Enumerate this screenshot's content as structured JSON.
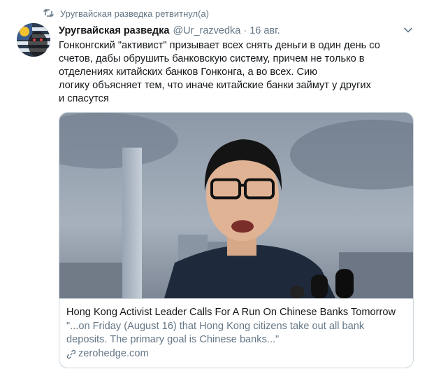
{
  "retweet": {
    "icon": "retweet-icon",
    "text": "Уругвайская разведка ретвитнул(а)"
  },
  "tweet": {
    "author_name": "Уругвайская разведка",
    "handle": "@Ur_razvedka",
    "separator": "·",
    "date": "16 авг.",
    "text": "Гонконгский \"активист\" призывает всех снять деньги в один день со\nсчетов, дабы обрушить банковскую систему, причем не только  в\nотделениях китайских банков Гонконга, а во всех. Сию\nлогику объясняет тем, что иначе китайские банки займут у других\nи спасутся"
  },
  "card": {
    "title": "Hong Kong Activist Leader Calls For A Run On Chinese Banks Tomorrow",
    "description": "\"...on Friday (August 16) that Hong Kong citizens take out all bank deposits. The primary goal is Chinese banks...\"",
    "domain": "zerohedge.com",
    "link_icon": "link-icon"
  },
  "menu_icon": "chevron-down-icon",
  "colors": {
    "secondary_text": "#657786",
    "primary_text": "#14171a",
    "border": "#ccd6dd"
  }
}
